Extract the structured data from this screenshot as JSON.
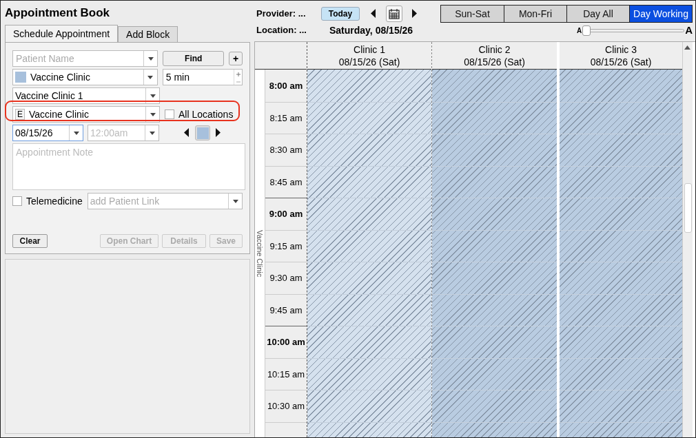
{
  "title": "Appointment Book",
  "tabs": [
    {
      "label": "Schedule Appointment",
      "selected": true
    },
    {
      "label": "Add Block",
      "selected": false
    }
  ],
  "form": {
    "patient_name": {
      "placeholder": "Patient Name"
    },
    "find_button": "Find",
    "add_button": "+",
    "appointment_type": {
      "value": "Vaccine Clinic",
      "color": "#a7c0dc"
    },
    "duration": {
      "value": "5 min"
    },
    "location": {
      "value": "Vaccine Clinic 1"
    },
    "facility": {
      "badge": "E",
      "value": "Vaccine Clinic",
      "highlighted": true
    },
    "all_locations": {
      "label": "All Locations",
      "checked": false
    },
    "date": {
      "value": "08/15/26"
    },
    "time": {
      "placeholder": "12:00am"
    },
    "swatch": {
      "color": "#a7c0dc"
    },
    "note": {
      "placeholder": "Appointment Note"
    },
    "telemedicine": {
      "label": "Telemedicine",
      "checked": false
    },
    "patient_link": {
      "placeholder": "add Patient Link"
    },
    "buttons": [
      {
        "label": "Clear",
        "disabled": false
      },
      {
        "label": "Open Chart",
        "disabled": true
      },
      {
        "label": "Details",
        "disabled": true
      },
      {
        "label": "Save",
        "disabled": true
      }
    ]
  },
  "toolbar": {
    "provider": "Provider: ...",
    "location": "Location: ...",
    "today": "Today",
    "date_title": "Saturday, 08/15/26",
    "views": [
      {
        "label": "Sun-Sat",
        "selected": false
      },
      {
        "label": "Mon-Fri",
        "selected": false
      },
      {
        "label": "Day All",
        "selected": false
      },
      {
        "label": "Day Working",
        "selected": true
      }
    ],
    "font_size": {
      "small": "A",
      "large": "A",
      "level": 0.0
    }
  },
  "schedule": {
    "side_label": "Vaccine Clinic",
    "columns": [
      {
        "name": "Clinic 1",
        "date": "08/15/26 (Sat)",
        "color": "#d5e1ee"
      },
      {
        "name": "Clinic 2",
        "date": "08/15/26 (Sat)",
        "color": "#b9cce1"
      },
      {
        "name": "Clinic 3",
        "date": "08/15/26 (Sat)",
        "color": "#b9cce1"
      }
    ],
    "times": [
      {
        "label": "8:00 am",
        "kind": "hour"
      },
      {
        "label": "8:15 am",
        "kind": "quarter"
      },
      {
        "label": "8:30 am",
        "kind": "quarter"
      },
      {
        "label": "8:45 am",
        "kind": "quarter"
      },
      {
        "label": "9:00 am",
        "kind": "hour"
      },
      {
        "label": "9:15 am",
        "kind": "quarter"
      },
      {
        "label": "9:30 am",
        "kind": "quarter"
      },
      {
        "label": "9:45 am",
        "kind": "quarter"
      },
      {
        "label": "10:00 am",
        "kind": "hour"
      },
      {
        "label": "10:15 am",
        "kind": "quarter"
      },
      {
        "label": "10:30 am",
        "kind": "quarter"
      }
    ]
  }
}
